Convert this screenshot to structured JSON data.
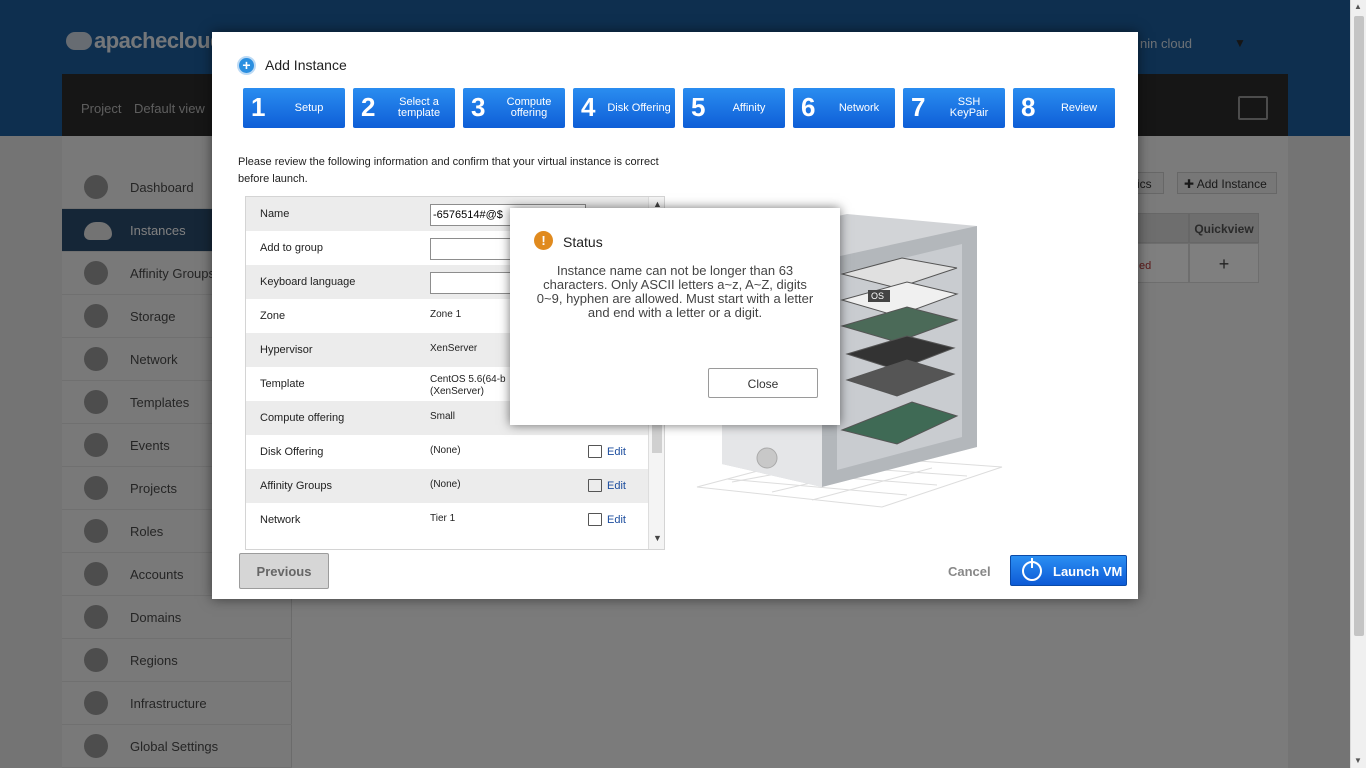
{
  "brand": "apachecloud",
  "user": "nin cloud",
  "project": {
    "label": "Project",
    "value": "Default view"
  },
  "sidebar": {
    "items": [
      {
        "label": "Dashboard"
      },
      {
        "label": "Instances"
      },
      {
        "label": "Affinity Groups"
      },
      {
        "label": "Storage"
      },
      {
        "label": "Network"
      },
      {
        "label": "Templates"
      },
      {
        "label": "Events"
      },
      {
        "label": "Projects"
      },
      {
        "label": "Roles"
      },
      {
        "label": "Accounts"
      },
      {
        "label": "Domains"
      },
      {
        "label": "Regions"
      },
      {
        "label": "Infrastructure"
      },
      {
        "label": "Global Settings"
      }
    ],
    "active_index": 1
  },
  "background": {
    "metrics_btn": "rics",
    "add_instance_btn": "Add Instance",
    "quickview_header": "Quickview",
    "row_state": "ed",
    "quickview_plus": "+"
  },
  "wizard": {
    "title": "Add Instance",
    "steps": [
      {
        "num": "1",
        "label": "Setup"
      },
      {
        "num": "2",
        "label": "Select a template"
      },
      {
        "num": "3",
        "label": "Compute offering"
      },
      {
        "num": "4",
        "label": "Disk Offering"
      },
      {
        "num": "5",
        "label": "Affinity"
      },
      {
        "num": "6",
        "label": "Network"
      },
      {
        "num": "7",
        "label": "SSH KeyPair"
      },
      {
        "num": "8",
        "label": "Review"
      }
    ],
    "review_text": "Please review the following information and confirm that your virtual instance is correct before launch.",
    "rows": [
      {
        "key": "Name",
        "input": "-6576514#@$",
        "type": "input"
      },
      {
        "key": "Add to group",
        "input": "",
        "type": "input"
      },
      {
        "key": "Keyboard language",
        "input": "",
        "type": "input"
      },
      {
        "key": "Zone",
        "value": "Zone 1",
        "type": "text"
      },
      {
        "key": "Hypervisor",
        "value": "XenServer",
        "type": "text"
      },
      {
        "key": "Template",
        "value": "CentOS 5.6(64-b (XenServer)",
        "type": "text"
      },
      {
        "key": "Compute offering",
        "value": "Small",
        "type": "text"
      },
      {
        "key": "Disk Offering",
        "value": "(None)",
        "type": "edit",
        "edit": "Edit"
      },
      {
        "key": "Affinity Groups",
        "value": "(None)",
        "type": "edit",
        "edit": "Edit"
      },
      {
        "key": "Network",
        "value": "Tier 1",
        "type": "edit",
        "edit": "Edit"
      }
    ],
    "previous_btn": "Previous",
    "cancel_btn": "Cancel",
    "launch_btn": "Launch VM",
    "os_label": "OS"
  },
  "status_dialog": {
    "title": "Status",
    "message": "Instance name can not be longer than 63 characters. Only ASCII letters a~z, A~Z, digits 0~9, hyphen are allowed. Must start with a letter and end with a letter or a digit.",
    "close_btn": "Close"
  }
}
